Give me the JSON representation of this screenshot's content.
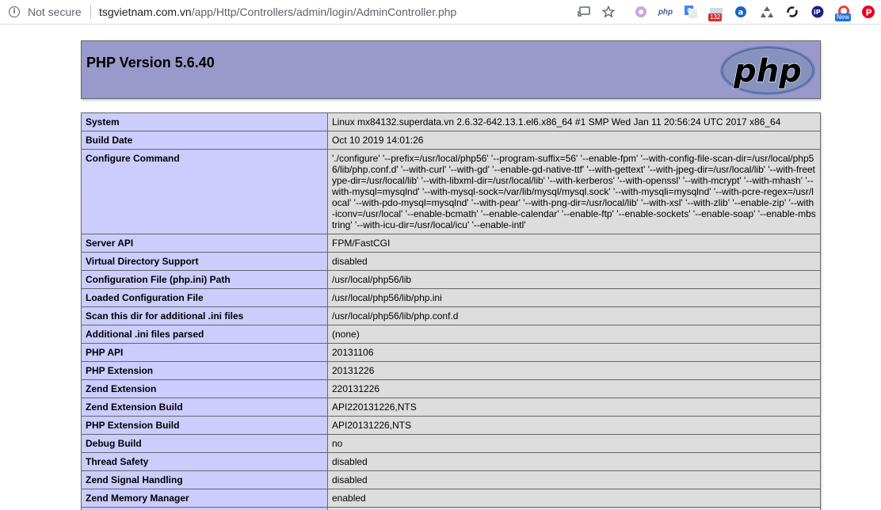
{
  "browser": {
    "security_label": "Not secure",
    "url_host": "tsgvietnam.com.vn",
    "url_path": "/app/Http/Controllers/admin/login/AdminController.php",
    "extension_badges": {
      "php_ext_label": "php",
      "mail_count": "132",
      "new_badge": "New"
    }
  },
  "phpinfo": {
    "title": "PHP Version 5.6.40",
    "logo_text": "php",
    "rows": [
      {
        "key": "System",
        "value": "Linux mx84132.superdata.vn 2.6.32-642.13.1.el6.x86_64 #1 SMP Wed Jan 11 20:56:24 UTC 2017 x86_64"
      },
      {
        "key": "Build Date",
        "value": "Oct 10 2019 14:01:26"
      },
      {
        "key": "Configure Command",
        "value": "'./configure' '--prefix=/usr/local/php56' '--program-suffix=56' '--enable-fpm' '--with-config-file-scan-dir=/usr/local/php56/lib/php.conf.d' '--with-curl' '--with-gd' '--enable-gd-native-ttf' '--with-gettext' '--with-jpeg-dir=/usr/local/lib' '--with-freetype-dir=/usr/local/lib' '--with-libxml-dir=/usr/local/lib' '--with-kerberos' '--with-openssl' '--with-mcrypt' '--with-mhash' '--with-mysql=mysqlnd' '--with-mysql-sock=/var/lib/mysql/mysql.sock' '--with-mysqli=mysqlnd' '--with-pcre-regex=/usr/local' '--with-pdo-mysql=mysqlnd' '--with-pear' '--with-png-dir=/usr/local/lib' '--with-xsl' '--with-zlib' '--enable-zip' '--with-iconv=/usr/local' '--enable-bcmath' '--enable-calendar' '--enable-ftp' '--enable-sockets' '--enable-soap' '--enable-mbstring' '--with-icu-dir=/usr/local/icu' '--enable-intl'"
      },
      {
        "key": "Server API",
        "value": "FPM/FastCGI"
      },
      {
        "key": "Virtual Directory Support",
        "value": "disabled"
      },
      {
        "key": "Configuration File (php.ini) Path",
        "value": "/usr/local/php56/lib"
      },
      {
        "key": "Loaded Configuration File",
        "value": "/usr/local/php56/lib/php.ini"
      },
      {
        "key": "Scan this dir for additional .ini files",
        "value": "/usr/local/php56/lib/php.conf.d"
      },
      {
        "key": "Additional .ini files parsed",
        "value": "(none)"
      },
      {
        "key": "PHP API",
        "value": "20131106"
      },
      {
        "key": "PHP Extension",
        "value": "20131226"
      },
      {
        "key": "Zend Extension",
        "value": "220131226"
      },
      {
        "key": "Zend Extension Build",
        "value": "API220131226,NTS"
      },
      {
        "key": "PHP Extension Build",
        "value": "API20131226,NTS"
      },
      {
        "key": "Debug Build",
        "value": "no"
      },
      {
        "key": "Thread Safety",
        "value": "disabled"
      },
      {
        "key": "Zend Signal Handling",
        "value": "disabled"
      },
      {
        "key": "Zend Memory Manager",
        "value": "enabled"
      },
      {
        "key": "",
        "value": ""
      }
    ]
  }
}
